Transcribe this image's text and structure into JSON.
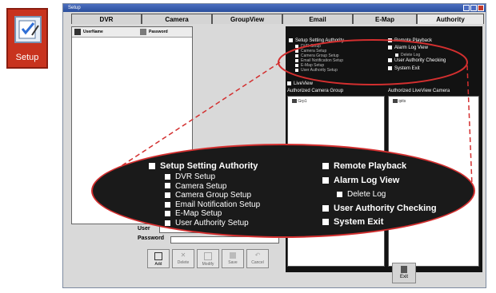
{
  "setup_tile": {
    "label": "Setup"
  },
  "window": {
    "title": "Setup"
  },
  "tabs": [
    {
      "label": "DVR",
      "active": false
    },
    {
      "label": "Camera",
      "active": false
    },
    {
      "label": "GroupView",
      "active": false
    },
    {
      "label": "Email",
      "active": false
    },
    {
      "label": "E-Map",
      "active": false
    },
    {
      "label": "Authority",
      "active": true
    }
  ],
  "userlist": {
    "col_user": "UserName",
    "col_pass": "Password"
  },
  "authority_panel": {
    "setup_setting_authority": "Setup Setting Authority",
    "setup_items": [
      "DVR Setup",
      "Camera Setup",
      "Camera Group Setup",
      "Email Notification Setup",
      "E-Map Setup",
      "User Authority Setup"
    ],
    "remote_playback": "Remote Playback",
    "alarm_log_view": "Alarm Log View",
    "delete_log": "Delete Log",
    "user_authority_checking": "User Authority Checking",
    "system_exit": "System Exit",
    "liveview": "LiveView",
    "authorized_camera_group": "Authorized Camera Group",
    "authorized_liveview_camera": "Authorized LiveView Camera",
    "camera_group_item": "Grp1",
    "liveview_camera_item": "ipits"
  },
  "form": {
    "user_label": "User",
    "password_label": "Password",
    "buttons": [
      "Add",
      "Delete",
      "Modify",
      "Save",
      "Cancel"
    ]
  },
  "exit_label": "Exit",
  "zoom": {
    "setup_setting_authority": "Setup Setting Authority",
    "setup_items": [
      "DVR Setup",
      "Camera Setup",
      "Camera Group Setup",
      "Email Notification Setup",
      "E-Map Setup",
      "User Authority Setup"
    ],
    "remote_playback": "Remote Playback",
    "alarm_log_view": "Alarm Log View",
    "delete_log": "Delete Log",
    "user_authority_checking": "User Authority Checking",
    "system_exit": "System Exit"
  },
  "colors": {
    "accent_red": "#d32f2f",
    "panel_black": "#121212",
    "setup_red": "#c8331e"
  },
  "icons": [
    "setup-checklist-icon",
    "user-icon",
    "password-key-icon",
    "add-icon",
    "delete-icon",
    "modify-icon",
    "save-icon",
    "cancel-icon",
    "exit-icon",
    "camera-group-icon",
    "camera-icon"
  ]
}
